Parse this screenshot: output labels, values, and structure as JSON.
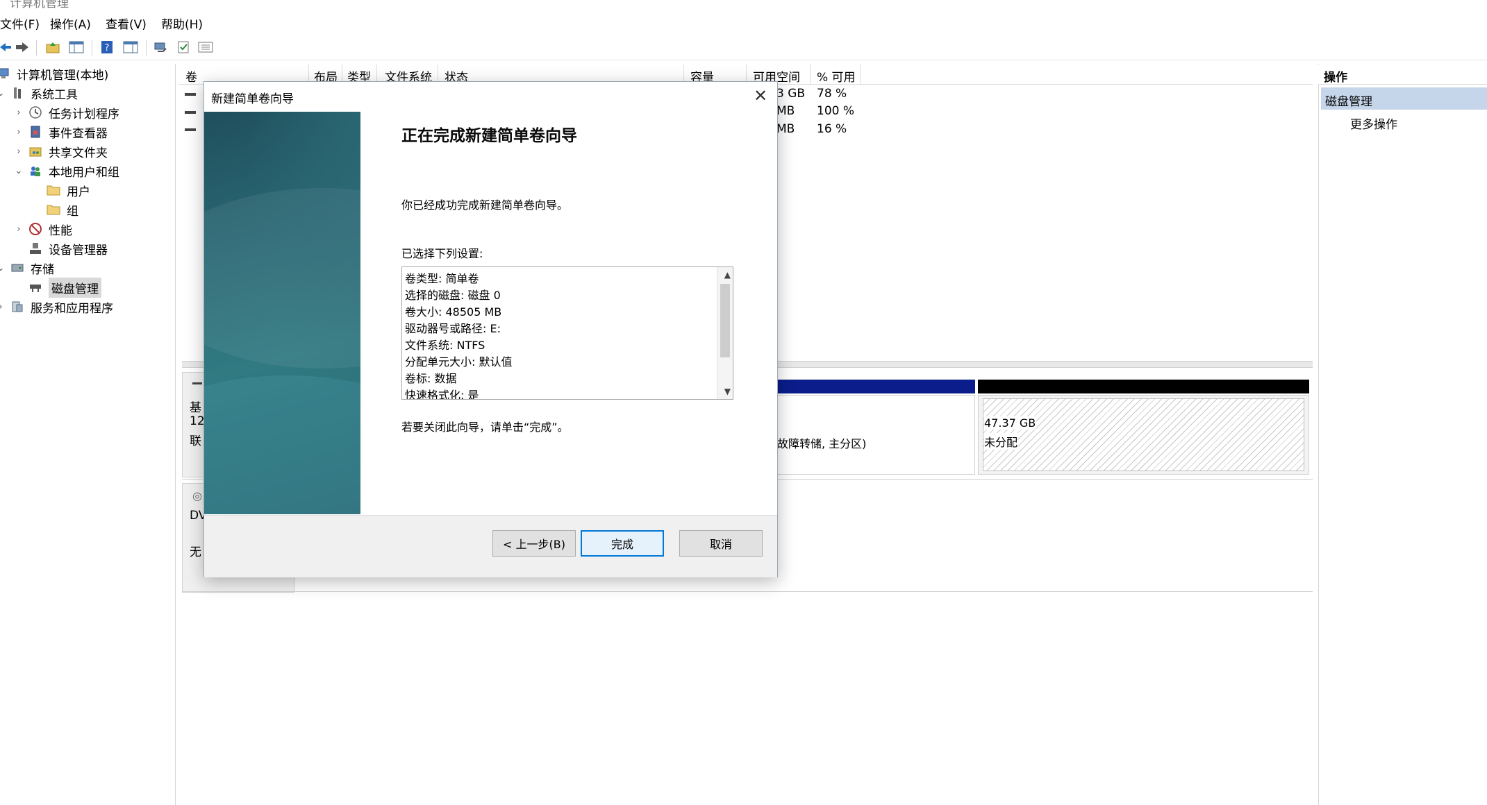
{
  "window": {
    "title": "计算机管理"
  },
  "menubar": [
    {
      "label": "文件(F)"
    },
    {
      "label": "操作(A)"
    },
    {
      "label": "查看(V)"
    },
    {
      "label": "帮助(H)"
    }
  ],
  "tree": {
    "root": "计算机管理(本地)",
    "system_tools": "系统工具",
    "task_scheduler": "任务计划程序",
    "event_viewer": "事件查看器",
    "shared_folders": "共享文件夹",
    "local_users": "本地用户和组",
    "users": "用户",
    "groups": "组",
    "performance": "性能",
    "device_manager": "设备管理器",
    "storage": "存储",
    "disk_management": "磁盘管理",
    "services_apps": "服务和应用程序"
  },
  "volume_list": {
    "headers": [
      "卷",
      "布局",
      "类型",
      "文件系统",
      "状态",
      "容量",
      "可用空间",
      "% 可用"
    ],
    "rows": [
      {
        "free": "3 GB",
        "pct": "78 %"
      },
      {
        "free": "MB",
        "pct": "100 %"
      },
      {
        "free": "MB",
        "pct": "16 %"
      }
    ]
  },
  "disk_area": {
    "disk0_fragments": [
      "基",
      "12",
      "联"
    ],
    "cdrom_fragments": [
      "DV",
      "无"
    ],
    "partition1_status": "故障转储, 主分区)",
    "unallocated_size": "47.37 GB",
    "unallocated_label": "未分配"
  },
  "actions": {
    "header": "操作",
    "selected": "磁盘管理",
    "more": "更多操作"
  },
  "dialog": {
    "title": "新建简单卷向导",
    "heading": "正在完成新建简单卷向导",
    "success_text": "你已经成功完成新建简单卷向导。",
    "settings_label": "已选择下列设置:",
    "settings": [
      "卷类型: 简单卷",
      "选择的磁盘: 磁盘 0",
      "卷大小: 48505 MB",
      "驱动器号或路径: E:",
      "文件系统: NTFS",
      "分配单元大小: 默认值",
      "卷标: 数据",
      "快速格式化: 是"
    ],
    "close_hint": "若要关闭此向导，请单击“完成”。",
    "back_button": "< 上一步(B)",
    "finish_button": "完成",
    "cancel_button": "取消"
  },
  "colors": {
    "partition_bar_primary": "#0a1d8a",
    "partition_bar_unallocated": "#000000",
    "selection": "#c5d6ea",
    "dialog_side_panel": "#2a6773",
    "primary_button_border": "#0078d7"
  }
}
